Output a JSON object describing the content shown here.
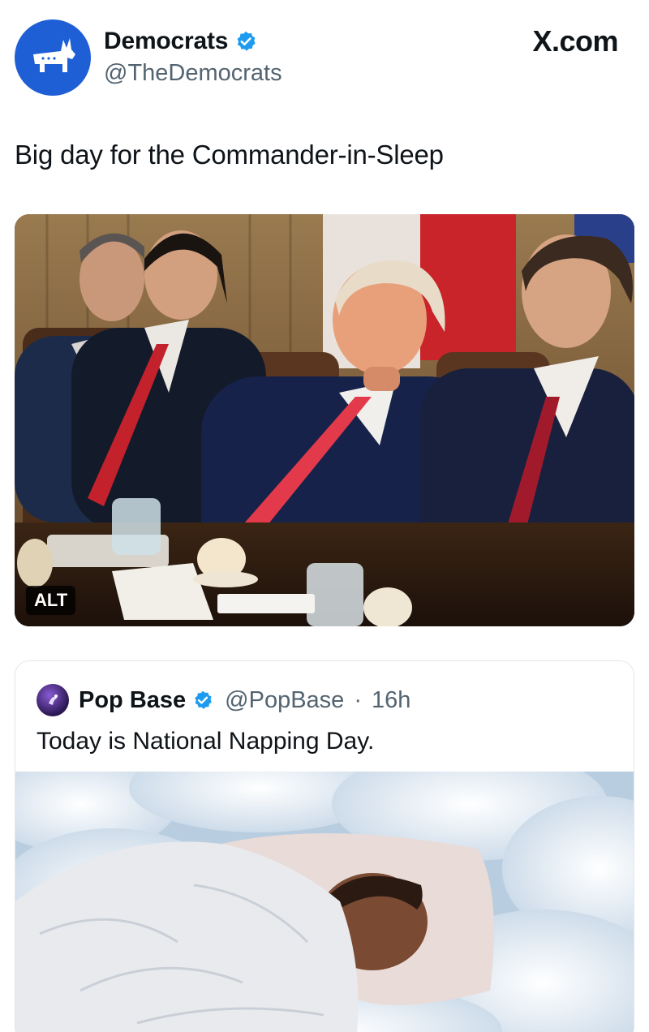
{
  "author": {
    "display_name": "Democrats",
    "handle": "@TheDemocrats",
    "avatar_icon": "donkey-logo-icon",
    "avatar_color": "#1f5fd6",
    "verified": true
  },
  "brand": {
    "label": "X.com"
  },
  "tweet": {
    "text": "Big day for the Commander-in-Sleep"
  },
  "media": {
    "alt_badge": "ALT"
  },
  "quote": {
    "display_name": "Pop Base",
    "handle": "@PopBase",
    "separator": "·",
    "time": "16h",
    "verified": true,
    "text": "Today is National Napping Day."
  },
  "colors": {
    "verified_blue": "#1d9bf0",
    "secondary_text": "#536471",
    "primary_text": "#0f1419"
  }
}
